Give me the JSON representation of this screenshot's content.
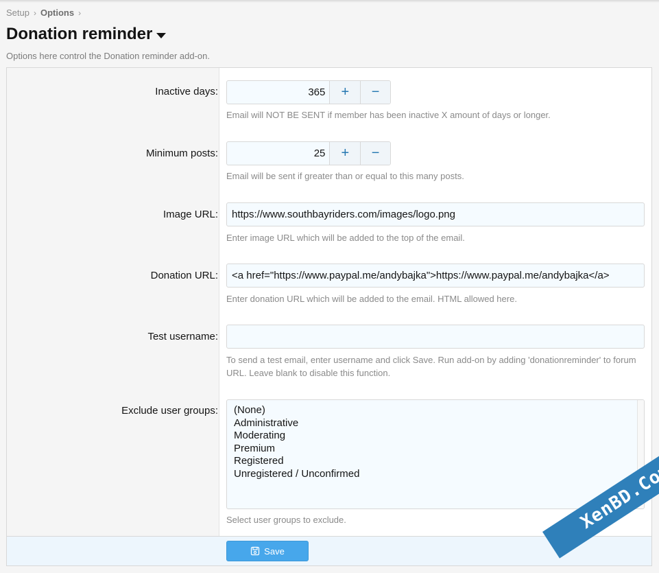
{
  "breadcrumb": [
    {
      "label": "Setup"
    },
    {
      "label": "Options"
    }
  ],
  "breadcrumb_separator": "›",
  "page_title": "Donation reminder",
  "page_description": "Options here control the Donation reminder add-on.",
  "fields": {
    "inactive_days": {
      "label": "Inactive days:",
      "value": "365",
      "hint": "Email will NOT BE SENT if member has been inactive X amount of days or longer."
    },
    "minimum_posts": {
      "label": "Minimum posts:",
      "value": "25",
      "hint": "Email will be sent if greater than or equal to this many posts."
    },
    "image_url": {
      "label": "Image URL:",
      "value": "https://www.southbayriders.com/images/logo.png",
      "hint": "Enter image URL which will be added to the top of the email."
    },
    "donation_url": {
      "label": "Donation URL:",
      "value": "<a href=\"https://www.paypal.me/andybajka\">https://www.paypal.me/andybajka</a>",
      "hint": "Enter donation URL which will be added to the email. HTML allowed here."
    },
    "test_username": {
      "label": "Test username:",
      "value": "",
      "hint": "To send a test email, enter username and click Save. Run add-on by adding 'donationreminder' to forum URL. Leave blank to disable this function."
    },
    "exclude_groups": {
      "label": "Exclude user groups:",
      "options": [
        "(None)",
        "Administrative",
        "Moderating",
        "Premium",
        "Registered",
        "Unregistered / Unconfirmed"
      ],
      "hint": "Select user groups to exclude."
    }
  },
  "stepper": {
    "plus": "+",
    "minus": "−"
  },
  "save_label": "Save",
  "watermark": "XenBD.Com",
  "colors": {
    "accent": "#47a7eb",
    "link": "#2577b1",
    "watermark": "#2f80ba"
  }
}
